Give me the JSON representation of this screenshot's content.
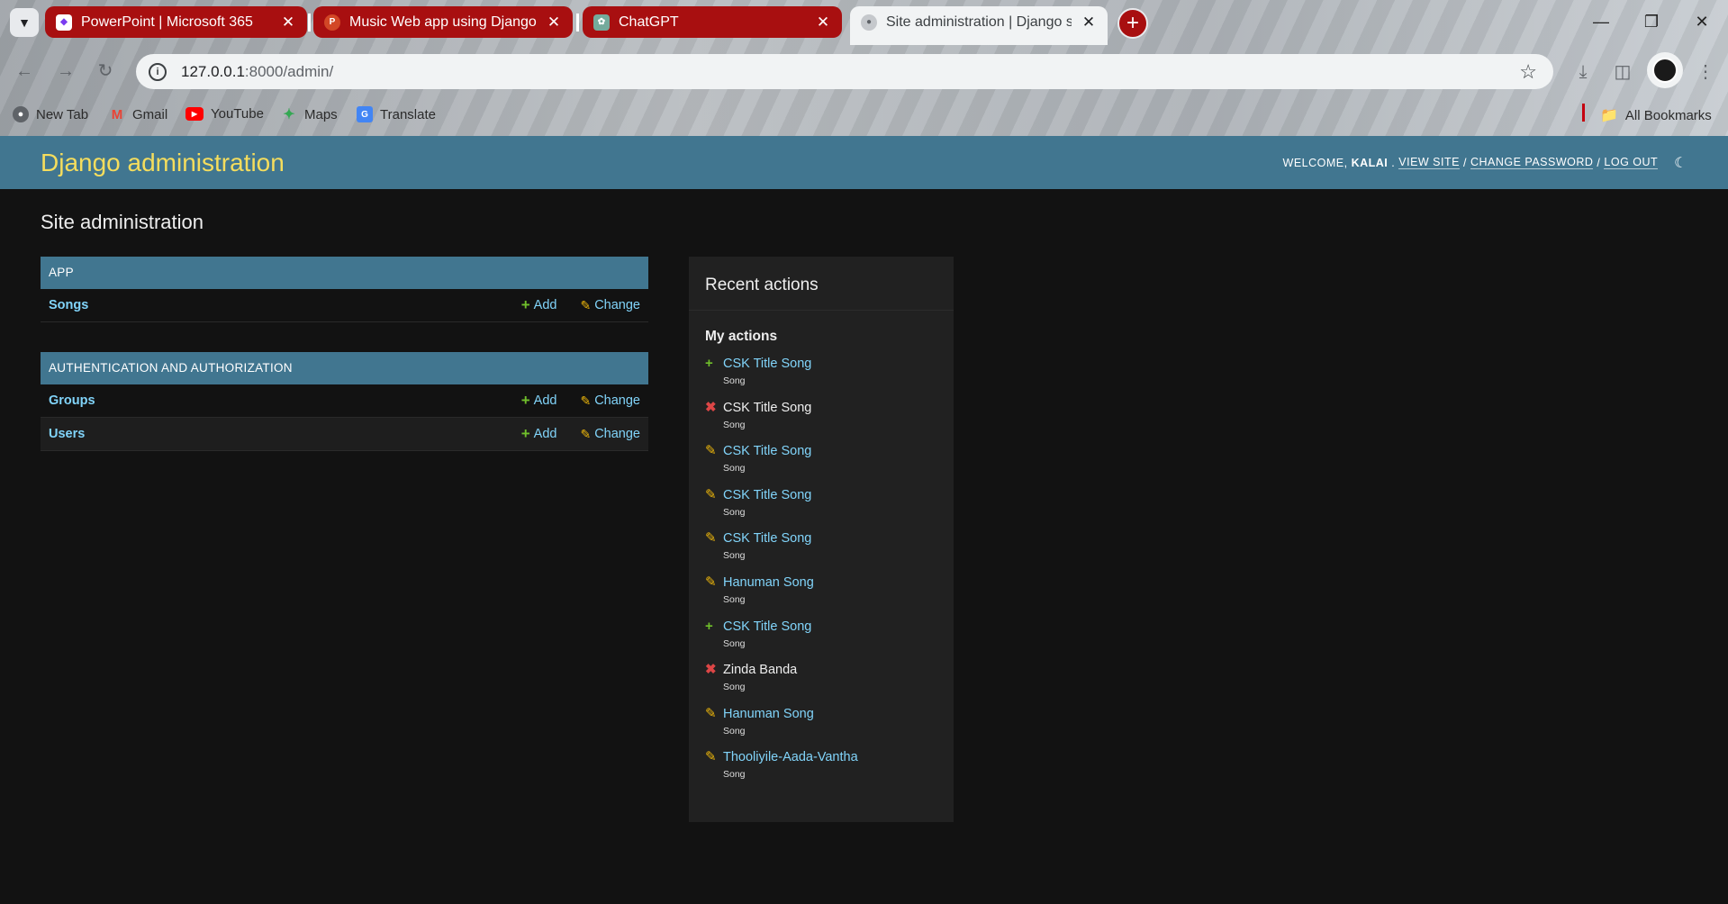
{
  "browser": {
    "tabs": [
      {
        "title": "PowerPoint | Microsoft 365",
        "favicon": "powerpoint-icon",
        "active": false
      },
      {
        "title": "Music Web app using Django F",
        "favicon": "powerpoint-file-icon",
        "active": false
      },
      {
        "title": "ChatGPT",
        "favicon": "chatgpt-icon",
        "active": false
      },
      {
        "title": "Site administration | Django site",
        "favicon": "globe-icon",
        "active": true
      }
    ],
    "address_bar": {
      "host": "127.0.0.1",
      "path": ":8000/admin/"
    },
    "bookmarks": [
      {
        "label": "New Tab",
        "icon": "globe-icon"
      },
      {
        "label": "Gmail",
        "icon": "gmail-icon"
      },
      {
        "label": "YouTube",
        "icon": "youtube-icon"
      },
      {
        "label": "Maps",
        "icon": "maps-icon"
      },
      {
        "label": "Translate",
        "icon": "translate-icon"
      }
    ],
    "all_bookmarks_label": "All Bookmarks",
    "colors": {
      "tab_accent": "#a80f10"
    }
  },
  "header": {
    "branding": "Django administration",
    "welcome": "WELCOME,",
    "username": "KALAI",
    "view_site": "VIEW SITE",
    "change_password": "CHANGE PASSWORD",
    "log_out": "LOG OUT",
    "separator": "/"
  },
  "page": {
    "title": "Site administration"
  },
  "apps": [
    {
      "caption": "APP",
      "models": [
        {
          "name": "Songs",
          "add": "Add",
          "change": "Change"
        }
      ]
    },
    {
      "caption": "AUTHENTICATION AND AUTHORIZATION",
      "models": [
        {
          "name": "Groups",
          "add": "Add",
          "change": "Change"
        },
        {
          "name": "Users",
          "add": "Add",
          "change": "Change"
        }
      ]
    }
  ],
  "recent_actions": {
    "title": "Recent actions",
    "subtitle": "My actions",
    "items": [
      {
        "action": "add",
        "title": "CSK Title Song",
        "type": "Song"
      },
      {
        "action": "delete",
        "title": "CSK Title Song",
        "type": "Song"
      },
      {
        "action": "change",
        "title": "CSK Title Song",
        "type": "Song"
      },
      {
        "action": "change",
        "title": "CSK Title Song",
        "type": "Song"
      },
      {
        "action": "change",
        "title": "CSK Title Song",
        "type": "Song"
      },
      {
        "action": "change",
        "title": "Hanuman Song",
        "type": "Song"
      },
      {
        "action": "add",
        "title": "CSK Title Song",
        "type": "Song"
      },
      {
        "action": "delete",
        "title": "Zinda Banda",
        "type": "Song"
      },
      {
        "action": "change",
        "title": "Hanuman Song",
        "type": "Song"
      },
      {
        "action": "change",
        "title": "Thooliyile-Aada-Vantha",
        "type": "Song"
      }
    ]
  },
  "colors": {
    "header_bg": "#417690",
    "branding": "#f5dd5d",
    "link": "#81d4fa",
    "add": "#70bf2b",
    "change": "#efb80b",
    "delete": "#dd4646",
    "body_bg": "#121212"
  }
}
